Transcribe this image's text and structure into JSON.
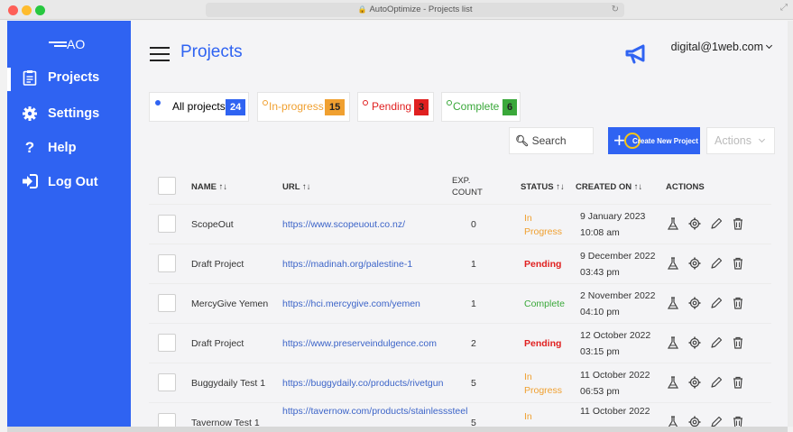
{
  "browser": {
    "title": "AutoOptimize - Projects list"
  },
  "sidebar": {
    "logo": "AO",
    "items": [
      {
        "label": "Projects",
        "icon": "clipboard-icon"
      },
      {
        "label": "Settings",
        "icon": "gear-icon"
      },
      {
        "label": "Help",
        "icon": "question-icon"
      },
      {
        "label": "Log Out",
        "icon": "logout-icon"
      }
    ]
  },
  "header": {
    "title": "Projects",
    "user": "digital@1web.com"
  },
  "filters": [
    {
      "label": "All projects",
      "count": "24",
      "dot_color": "#2f63f2",
      "badge_color": "#2f63f2",
      "text_color": "#333333",
      "badge_text": "#ffffff"
    },
    {
      "label": "In-progress",
      "count": "15",
      "dot_color": "#f0a030",
      "badge_color": "#f0a030",
      "text_color": "#f0a030",
      "badge_text": "#222222"
    },
    {
      "label": "Pending",
      "count": "3",
      "dot_color": "#e02020",
      "badge_color": "#e02020",
      "text_color": "#e02020",
      "badge_text": "#222222"
    },
    {
      "label": "Complete",
      "count": "6",
      "dot_color": "#3aa83a",
      "badge_color": "#3aa83a",
      "text_color": "#3aa83a",
      "badge_text": "#222222"
    }
  ],
  "toolbar": {
    "search_label": "Search",
    "create_label": "Create New Project",
    "actions_label": "Actions"
  },
  "table": {
    "headers": {
      "name": "NAME ↑↓",
      "url": "URL ↑↓",
      "exp_count_1": "EXP.",
      "exp_count_2": "COUNT",
      "status": "STATUS ↑↓",
      "created_on": "CREATED ON ↑↓",
      "actions": "ACTIONS"
    },
    "rows": [
      {
        "name": "ScopeOut",
        "url": "https://www.scopeuout.co.nz/",
        "count": "0",
        "status1": "In",
        "status2": "Progress",
        "status_type": "inprogress",
        "date": "9 January 2023",
        "time": "10:08 am"
      },
      {
        "name": "Draft Project",
        "url": "https://madinah.org/palestine-1",
        "count": "1",
        "status1": "Pending",
        "status2": "",
        "status_type": "pending",
        "date": "9 December 2022",
        "time": "03:43 pm"
      },
      {
        "name": "MercyGive Yemen",
        "url": "https://hci.mercygive.com/yemen",
        "count": "1",
        "status1": "Complete",
        "status2": "",
        "status_type": "complete",
        "date": "2 November 2022",
        "time": "04:10 pm"
      },
      {
        "name": "Draft Project",
        "url": "https://www.preserveindulgence.com",
        "count": "2",
        "status1": "Pending",
        "status2": "",
        "status_type": "pending",
        "date": "12 October 2022",
        "time": "03:15 pm"
      },
      {
        "name": "Buggydaily Test 1",
        "url": "https://buggydaily.co/products/rivetgun",
        "count": "5",
        "status1": "In",
        "status2": "Progress",
        "status_type": "inprogress",
        "date": "11 October 2022",
        "time": "06:53 pm"
      },
      {
        "name": "Tavernow Test 1",
        "url": "https://tavernow.com/products/stainlesssteel",
        "count": "5",
        "status1": "In",
        "status2": "",
        "status_type": "inprogress",
        "date": "11 October 2022",
        "time": ""
      }
    ]
  }
}
